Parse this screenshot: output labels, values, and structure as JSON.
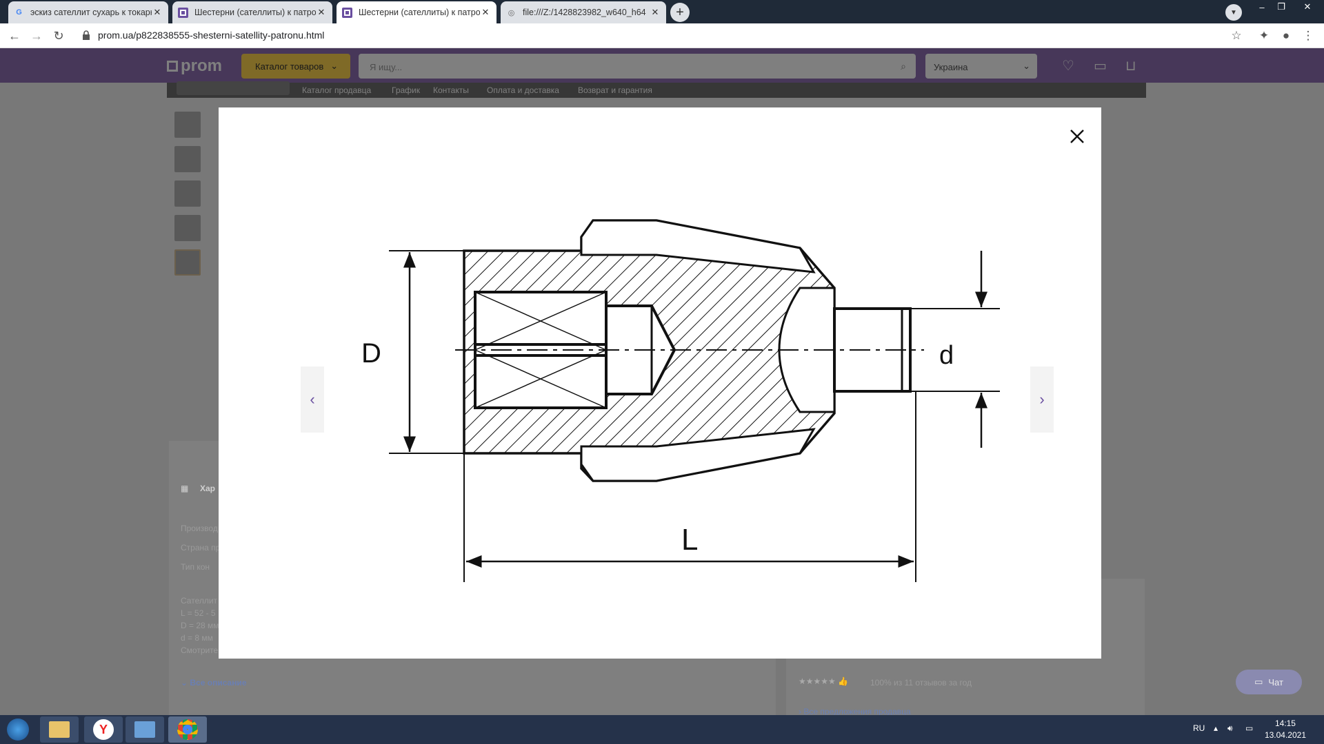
{
  "browser": {
    "tabs": [
      {
        "label": "эскиз сателлит сухарь к токарн",
        "favicon": "G"
      },
      {
        "label": "Шестерни (сателлиты) к патрон",
        "favicon": ""
      },
      {
        "label": "Шестерни (сателлиты) к патрон",
        "favicon": ""
      },
      {
        "label": "file:///Z:/1428823982_w640_h64",
        "favicon": ""
      }
    ],
    "url": "prom.ua/p822838555-shesterni-satellity-patronu.html"
  },
  "header": {
    "logo": "prom",
    "catalog_label": "Каталог товаров",
    "search_placeholder": "Я ищу...",
    "region": "Украина"
  },
  "subnav": {
    "items": [
      "Каталог продавца",
      "График",
      "Контакты",
      "Оплата и доставка",
      "Возврат и гарантия"
    ]
  },
  "background_text": {
    "characteristics": "Хар",
    "rows": [
      "Производ",
      "Страна пр",
      "Тип кон"
    ],
    "desc": [
      "Сателлит",
      "L = 52 - 5",
      "D = 28 мм",
      "d = 8 мм",
      "Смотрите"
    ],
    "all_description": "Все описание",
    "rating_text": "100% из 11 отзывов за год",
    "seller_offers": "Все предложения продавца",
    "chat": "Чат"
  },
  "drawing": {
    "label_D": "D",
    "label_d": "d",
    "label_L": "L"
  },
  "taskbar": {
    "lang": "RU",
    "time": "14:15",
    "date": "13.04.2021"
  },
  "colors": {
    "brand": "#8e6fb3",
    "accent": "#ffd54f",
    "arrow": "#6a4fa0"
  }
}
